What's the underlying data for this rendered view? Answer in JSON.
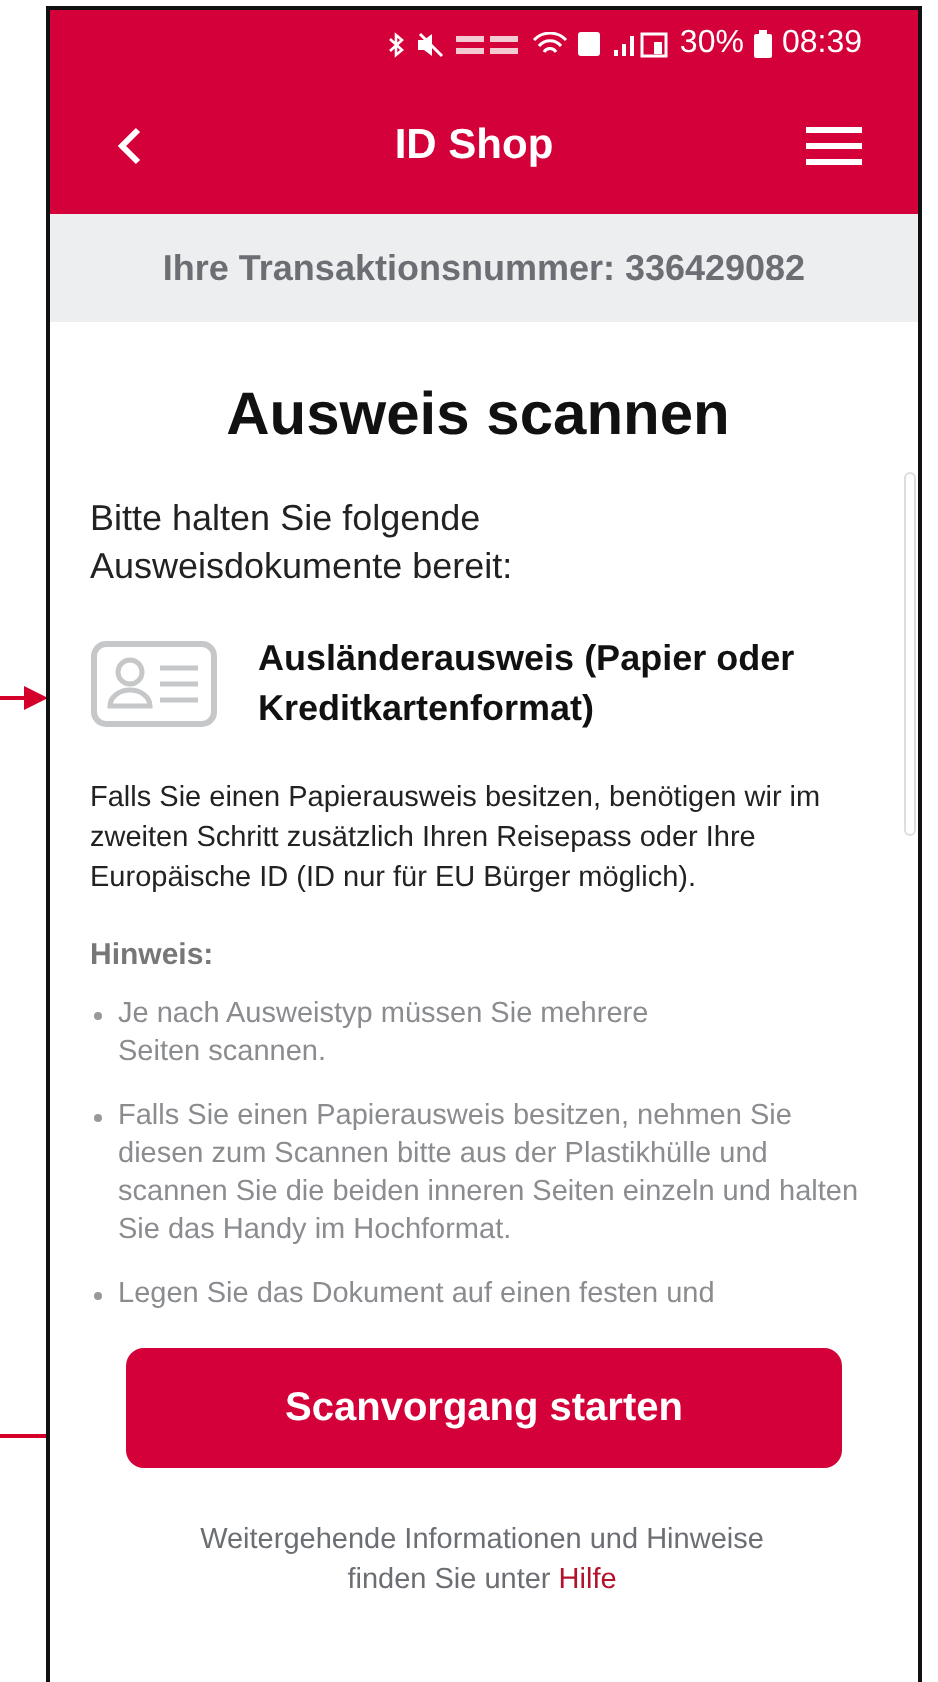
{
  "status_bar": {
    "battery": "30%",
    "time": "08:39"
  },
  "header": {
    "title": "ID Shop"
  },
  "transaction": "Ihre Transaktionsnummer: 336429082",
  "title": "Ausweis scannen",
  "intro": "Bitte halten Sie folgende Ausweisdokumente bereit:",
  "documents": [
    {
      "label": "Ausländerausweis (Papier oder Kreditkartenformat)"
    }
  ],
  "info": "Falls Sie einen Papierausweis besitzen, benötigen wir im zweiten Schritt zusätzlich Ihren Reisepass oder Ihre Europäische ID (ID nur für EU Bürger möglich).",
  "note": {
    "heading": "Hinweis:",
    "items": [
      "Je nach Ausweistyp müssen Sie mehrere Seiten scannen.",
      "Falls Sie einen Papierausweis besitzen, nehmen Sie diesen zum Scannen bitte aus der Plastikhülle und scannen Sie die beiden inneren Seiten einzeln und halten Sie das Handy im Hochformat.",
      "Legen Sie das Dokument auf einen festen und"
    ]
  },
  "button": "Scanvorgang starten",
  "footer": {
    "text": "Weitergehende Informationen und Hinweise finden Sie unter",
    "link": "Hilfe"
  }
}
